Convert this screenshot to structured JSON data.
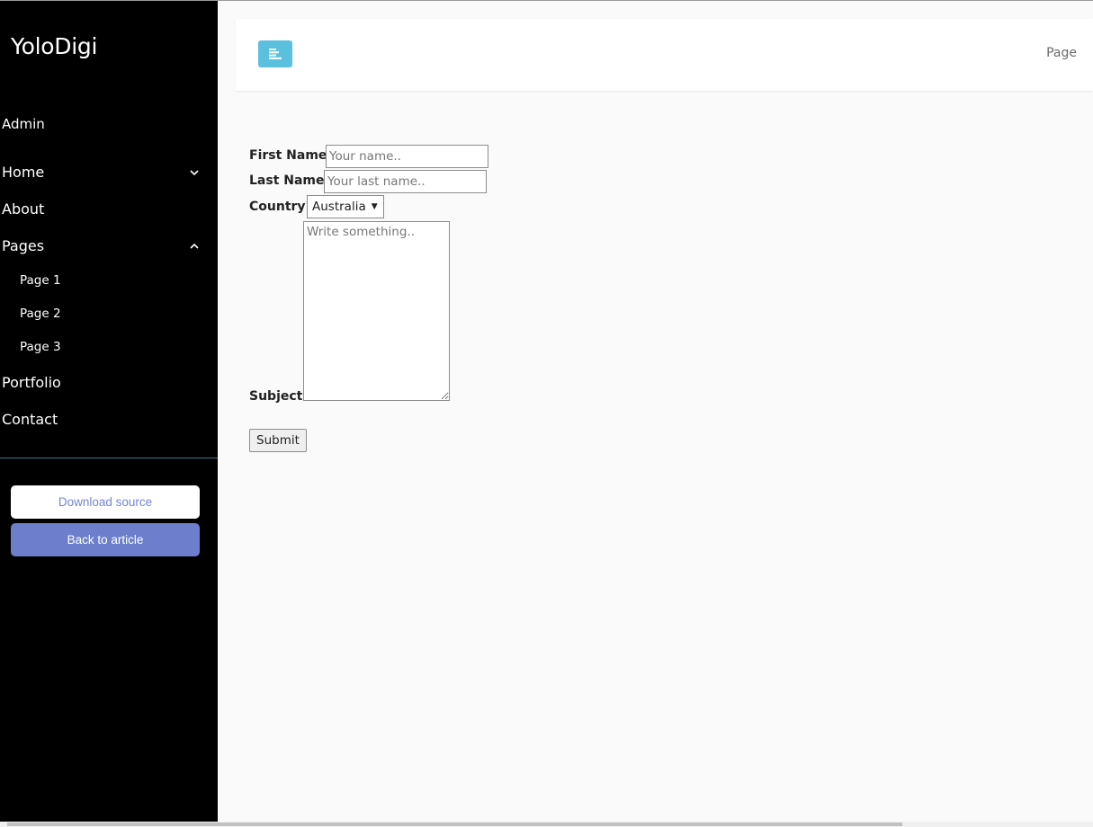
{
  "sidebar": {
    "brand": "YoloDigi",
    "section": "Admin",
    "nav": [
      {
        "label": "Home",
        "chevron": "chevron-down-icon"
      },
      {
        "label": "About"
      },
      {
        "label": "Pages",
        "chevron": "chevron-up-icon"
      },
      {
        "label": "Portfolio"
      },
      {
        "label": "Contact"
      }
    ],
    "subitems": [
      "Page 1",
      "Page 2",
      "Page 3"
    ],
    "download_label": "Download source",
    "back_label": "Back to article"
  },
  "topbar": {
    "toggle_icon": "align-left-icon",
    "page_link": "Page",
    "toggle_color": "#5bc0de"
  },
  "form": {
    "first_name_label": "First Name",
    "first_name_placeholder": "Your name..",
    "last_name_label": "Last Name",
    "last_name_placeholder": "Your last name..",
    "country_label": "Country",
    "country_value": "Australia",
    "subject_label": "Subject",
    "subject_placeholder": "Write something..",
    "submit_label": "Submit"
  },
  "colors": {
    "sidebar_bg": "#000000",
    "accent": "#7386d5",
    "back_button": "#6d7fcc"
  }
}
